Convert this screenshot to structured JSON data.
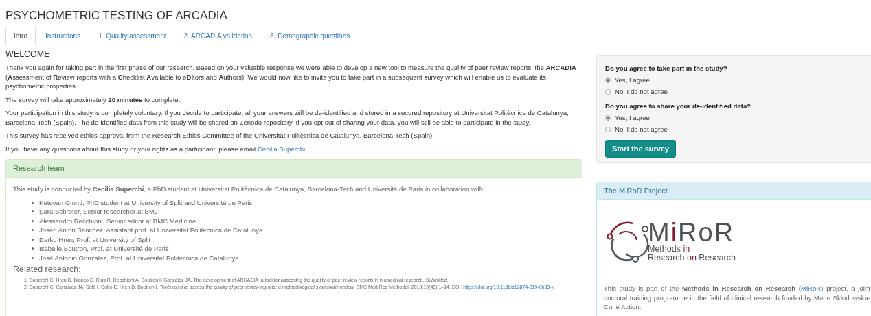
{
  "page_title": "PSYCHOMETRIC TESTING OF ARCADIA",
  "tabs": [
    {
      "label": "Intro",
      "selected": true
    },
    {
      "label": "Instructions",
      "selected": false
    },
    {
      "label": "1. Quality assessment",
      "selected": false
    },
    {
      "label": "2. ARCADIA validation",
      "selected": false
    },
    {
      "label": "3. Demographic questions",
      "selected": false
    }
  ],
  "welcome": {
    "heading": "WELCOME",
    "paragraphs": [
      [
        {
          "kind": "text",
          "text": "Thank you again for taking part in the first phase of our research. Based on your valuable response we were able to develop a new tool to measure the quality of peer review reports, the **ARCADIA** (**A**ssessment of **R**eview reports with a **C**hecklist **A**vailable to e**DI**tors and **A**uthors). We would now like to invite you to take part in a subsequent survey which will enable us to evaluate its psychometric properties."
        }
      ],
      [
        {
          "kind": "text",
          "text": "The survey will take approximately **20 minutes** to complete."
        }
      ],
      [
        {
          "kind": "text",
          "text": "Your participation in this study is completely voluntary. If you decide to participate, all your answers will be de-identified and stored in a secured repository at Universitat Politècnica de Catalunya, Barcelona-Tech (Spain). The de-identified data from this study will be shared on Zenodo repository. If you opt out of sharing your data, you will still be able to participate in the study."
        }
      ],
      [
        {
          "kind": "text",
          "text": "This survey has received ethics approval from the Research Ethics Committee of the Universitat Politècnica de Catalunya, Barcelona-Tech (Spain)."
        }
      ],
      [
        {
          "kind": "text",
          "text": "If you have any questions about this study or your rights as a participant, please email "
        },
        {
          "kind": "link",
          "text": "Cecilia Superchi"
        },
        {
          "kind": "text",
          "text": "."
        }
      ]
    ]
  },
  "research_team": {
    "heading": "Research team",
    "intro": "This study is conducted by **Cecilia Superchi**, a PhD student at Universitat Politècnica de Catalunya, Barcelona-Tech and Université de Paris in collaboration with:",
    "members": [
      "Ketevan Glonti, PhD student at University of Split and Université de Paris",
      "Sara Schroter, Senior researcher at BMJ",
      "Alessandro Recchioni, Senior editor at BMC Medicine",
      "Josep Anton Sánchez, Assistant prof. at Universitat Politècnica de Catalunya",
      "Darko Hren, Prof. at University of Split",
      "Isabelle Boutron, Prof. at Université de Paris",
      "José Antonio Gonzalez, Prof. at Universitat Politècnica de Catalunya"
    ],
    "related_heading": "Related research:",
    "references": [
      {
        "number": "1.",
        "parts": [
          {
            "kind": "text",
            "text": "Superchi C, Hren D, Blanco D, Rius R, Recchioni A, Boutron I, González JA. The development of ARCADIA: a tool for assessing the quality of peer review reports in biomedical research. *Submitted.*"
          }
        ]
      },
      {
        "number": "2.",
        "parts": [
          {
            "kind": "text",
            "text": "Superchi C, González JA, Solà I, Cobo E, Hren D, Boutron I. *Tools used to assess the quality of peer review reports: a methodological systematic review.* BMC Med Res Methodol. 2019;19(48):1–14. DOI: "
          },
          {
            "kind": "link",
            "text": "https://doi.org/10.1186/s12874-019-0688-x"
          }
        ]
      }
    ]
  },
  "consent": {
    "questions": [
      {
        "label": "Do you agree to take part in the study?",
        "options": [
          {
            "label": "Yes, I agree",
            "selected": true
          },
          {
            "label": "No, I do not agree",
            "selected": false
          }
        ]
      },
      {
        "label": "Do you agree to share your de-identified data?",
        "options": [
          {
            "label": "Yes, I agree",
            "selected": true
          },
          {
            "label": "No, I do not agree",
            "selected": false
          }
        ]
      }
    ],
    "button": "Start the survey"
  },
  "miror": {
    "heading": "The MiRoR Project",
    "logo": {
      "title": [
        {
          "text": "M",
          "accent": false
        },
        {
          "text": "i",
          "accent": true
        },
        {
          "text": "RoR",
          "accent": false
        }
      ],
      "lines": [
        [
          {
            "text": "Methods ",
            "accent": false
          },
          {
            "text": "in",
            "accent": true
          }
        ],
        [
          {
            "text": "Research ",
            "accent": false
          },
          {
            "text": "on",
            "accent": true
          },
          {
            "text": " Research",
            "accent": false
          }
        ]
      ]
    },
    "text": [
      {
        "kind": "text",
        "text": "This study is part of the **Methods in Research on Research** ("
      },
      {
        "kind": "link",
        "text": "MiRoR"
      },
      {
        "kind": "text",
        "text": ") project, a joint doctoral training programme in the field of clinical research funded by Marie Skłodowska-Curie Action."
      }
    ]
  }
}
